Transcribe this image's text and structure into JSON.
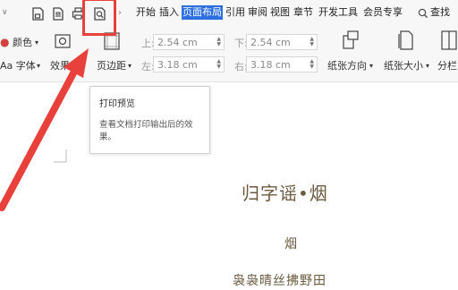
{
  "menu_tabs": {
    "start": "开始",
    "insert": "插入",
    "page_layout": "页面布局",
    "reference": "引用",
    "review": "审阅",
    "view": "视图",
    "section": "章节",
    "developer": "开发工具",
    "member": "会员专享",
    "search": "查找"
  },
  "ribbon": {
    "color": "颜色",
    "font": "Aa 字体",
    "effects": "效果",
    "margins": "页边距",
    "top_label": "上:",
    "top_value": "2.54 cm",
    "bottom_label": "下:",
    "bottom_value": "2.54 cm",
    "left_label": "左:",
    "left_value": "3.18 cm",
    "right_label": "右:",
    "right_value": "3.18 cm",
    "orientation": "纸张方向",
    "paper_size": "纸张大小",
    "columns": "分栏"
  },
  "tooltip": {
    "title": "打印预览",
    "description": "查看文档打印输出后的效果。"
  },
  "document": {
    "title": "归字谣•烟",
    "author": "烟",
    "line1": "袅袅晴丝拂野田"
  },
  "colors": {
    "accent": "#2b6fe0",
    "highlight": "#e8413c",
    "doc_text": "#6b5a3f"
  }
}
